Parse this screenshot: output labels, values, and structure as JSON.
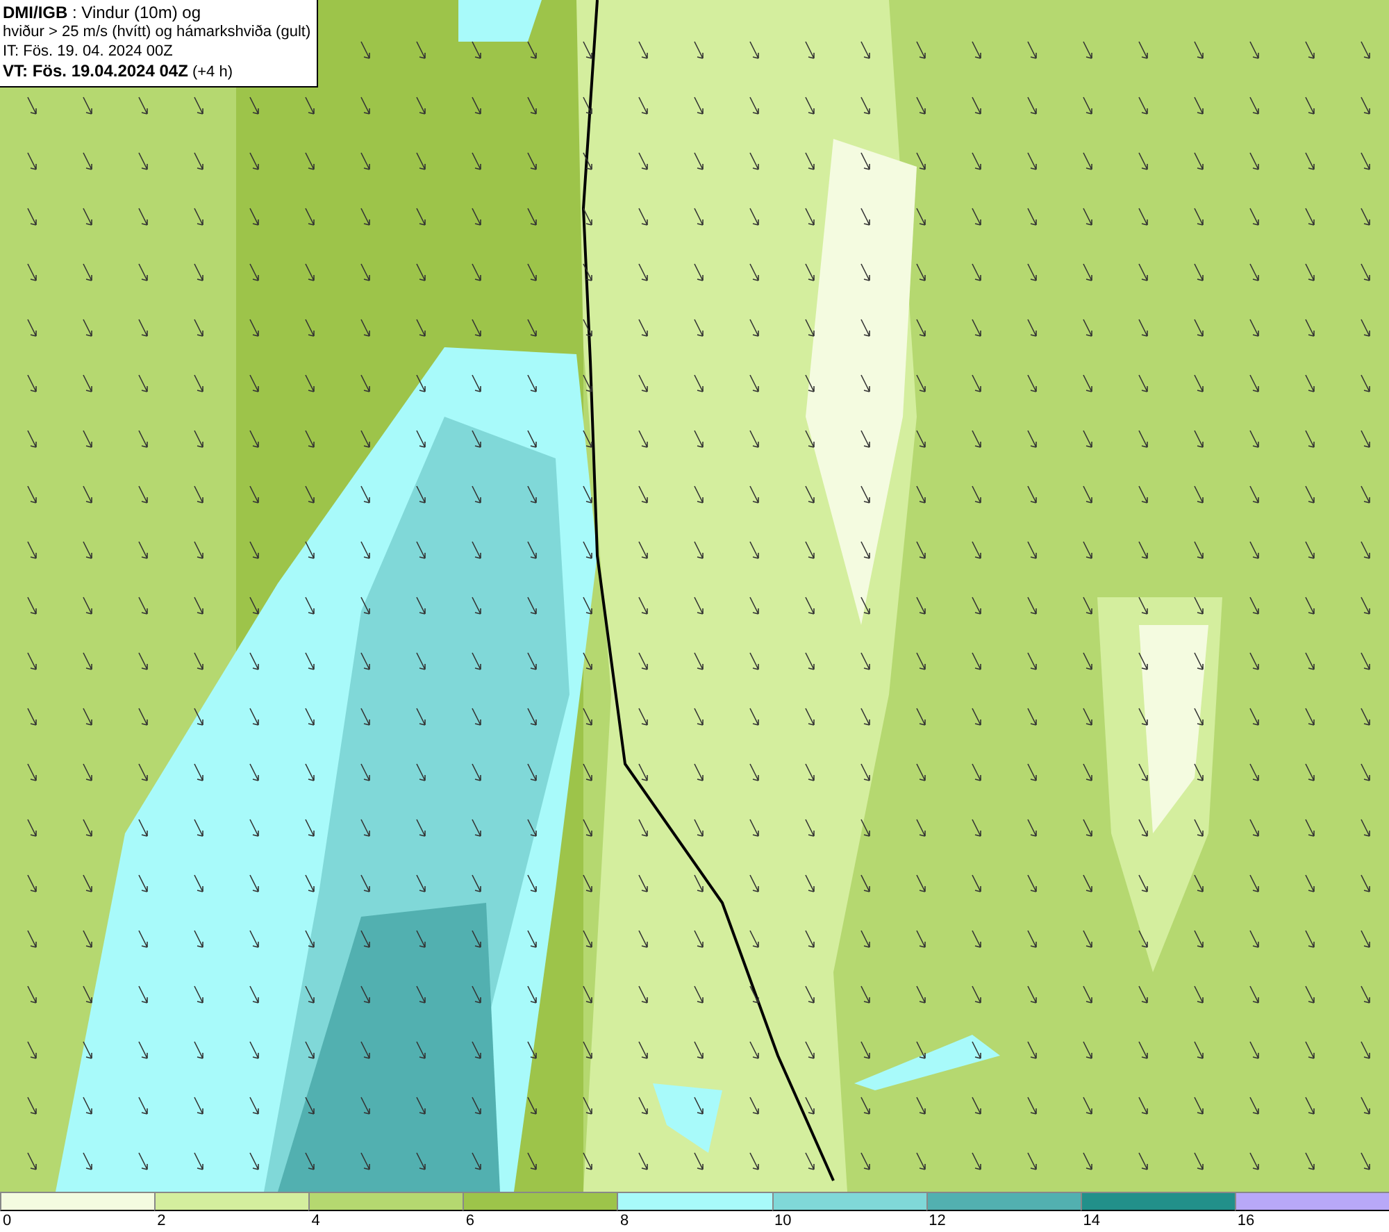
{
  "title_box": {
    "lines": [
      "**DMI/IGB** : Vindur (10m) og",
      "hviður > 25 m/s (hvítt) og hámarkshviða (gult)",
      "IT: Fös. 19. 04. 2024 00Z",
      "**VT: Fös. 19.04.2024 04Z** (+4 h)"
    ]
  },
  "legend": {
    "segments": [
      {
        "label": "0",
        "color": "#f4fbe0"
      },
      {
        "label": "2",
        "color": "#d4ee9e"
      },
      {
        "label": "4",
        "color": "#b5d870"
      },
      {
        "label": "6",
        "color": "#9dc44a"
      },
      {
        "label": "8",
        "color": "#a8fafa"
      },
      {
        "label": "10",
        "color": "#80d8d8"
      },
      {
        "label": "12",
        "color": "#52b0b0"
      },
      {
        "label": "14",
        "color": "#22908a"
      },
      {
        "label": "16",
        "color": "#b8a8f8"
      }
    ]
  }
}
